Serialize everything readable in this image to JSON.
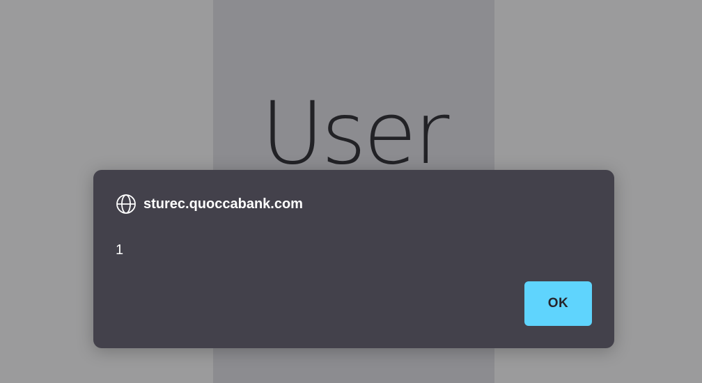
{
  "page": {
    "heading": "User"
  },
  "dialog": {
    "origin": "sturec.quoccabank.com",
    "origin_icon": "globe-icon",
    "message": "1",
    "ok_label": "OK",
    "colors": {
      "dialog_bg": "#43414b",
      "button_bg": "#5fd4fd",
      "overlay": "#9b9b9c"
    }
  }
}
